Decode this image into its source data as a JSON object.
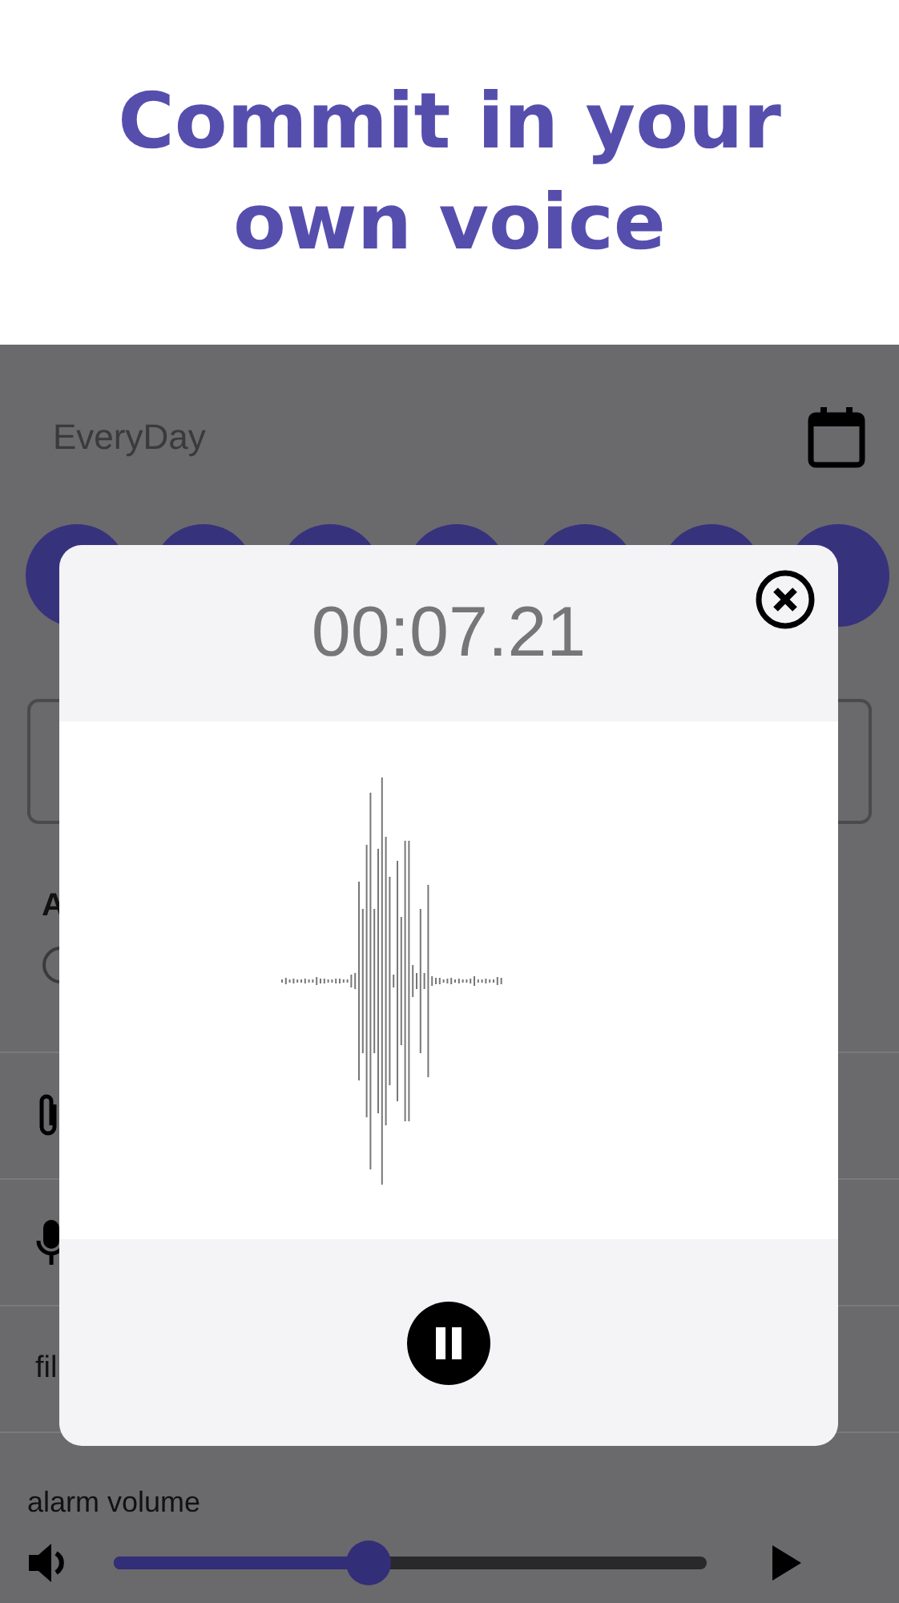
{
  "headline": "Commit in your own voice",
  "app_bar": {
    "title": "EveryDay"
  },
  "section": {
    "label": "A"
  },
  "rows": [
    {
      "kind": "attach"
    },
    {
      "kind": "mic"
    },
    {
      "kind": "text",
      "label": "fil"
    }
  ],
  "alarm_volume": {
    "label": "alarm volume",
    "level": 0.43
  },
  "recorder_dialog": {
    "timer": "00:07.21",
    "recording": true
  }
}
